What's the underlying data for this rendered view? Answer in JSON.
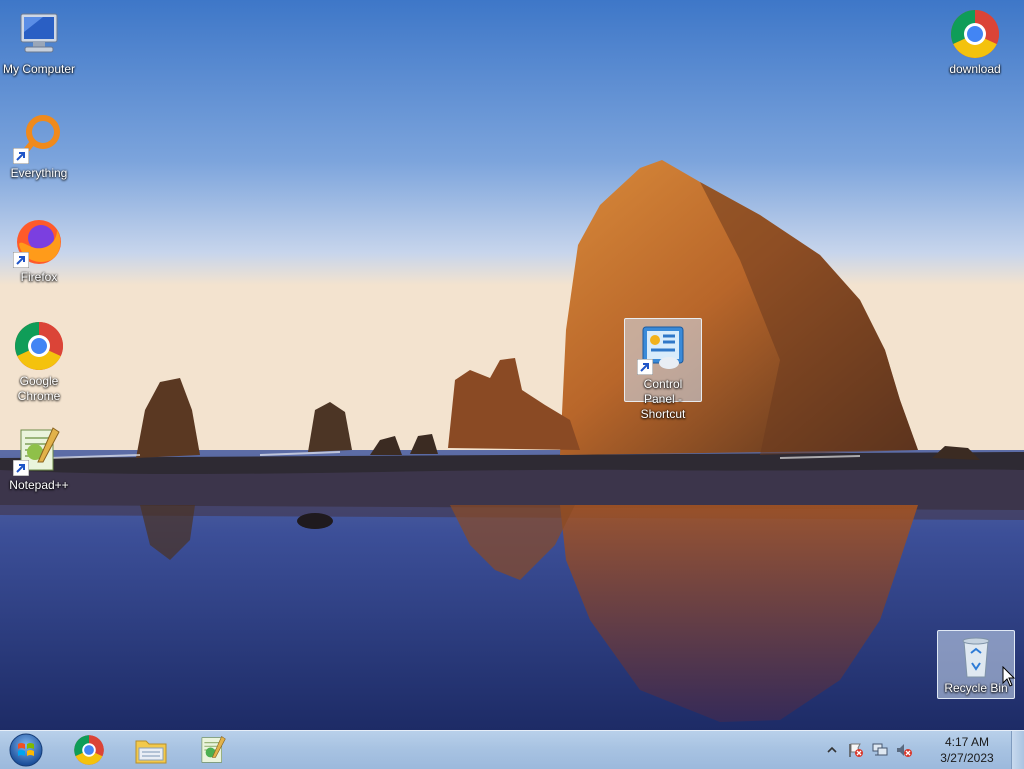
{
  "desktop_icons": [
    {
      "label": "My Computer",
      "icon": "computer-icon"
    },
    {
      "label": "Everything",
      "icon": "everything-search-icon",
      "shortcut": true
    },
    {
      "label": "Firefox",
      "icon": "firefox-icon",
      "shortcut": true
    },
    {
      "label": "Google Chrome",
      "icon": "chrome-icon"
    },
    {
      "label": "Notepad++",
      "icon": "notepadpp-icon",
      "shortcut": true
    },
    {
      "label": "download",
      "icon": "chrome-icon"
    },
    {
      "label": "Control Panel - Shortcut",
      "icon": "control-panel-icon",
      "shortcut": true,
      "selected": true
    },
    {
      "label": "Recycle Bin",
      "icon": "recycle-bin-icon",
      "selected": true
    }
  ],
  "taskbar": {
    "start_icon": "windows-start-orb-icon",
    "pinned": [
      "chrome-icon",
      "file-explorer-icon",
      "notepadpp-icon"
    ],
    "tray_icons": [
      "show-hidden-icons-chevron",
      "action-center-flag-icon",
      "network-icon",
      "volume-muted-icon"
    ],
    "clock": {
      "time": "4:17 AM",
      "date": "3/27/2023"
    }
  },
  "colors": {
    "taskbar": "#a8c3e2",
    "selection": "#d2e1f5",
    "sky_top": "#3f78c9",
    "rock": "#b8662a"
  }
}
